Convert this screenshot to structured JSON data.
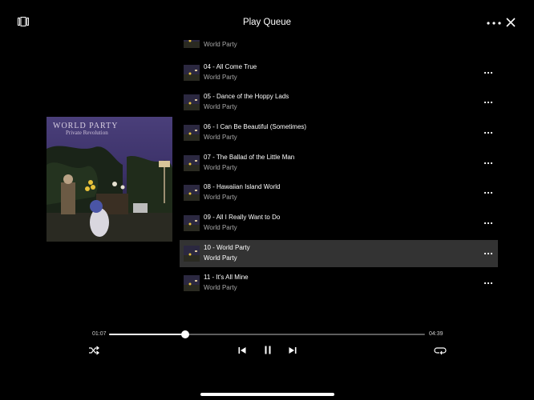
{
  "header": {
    "title": "Play Queue",
    "icons": {
      "left": "devices-icon",
      "more": "more-icon",
      "close": "close-icon"
    }
  },
  "album": {
    "art_text_band": "WORLD PARTY",
    "art_text_title": "Private Revolution"
  },
  "queue": {
    "partial_artist": "World Party",
    "tracks": [
      {
        "title": "04 - All Come True",
        "artist": "World Party",
        "active": false
      },
      {
        "title": "05 - Dance of the Hoppy Lads",
        "artist": "World Party",
        "active": false
      },
      {
        "title": "06 - I Can Be Beautiful (Sometimes)",
        "artist": "World Party",
        "active": false
      },
      {
        "title": "07 - The Ballad of the Little Man",
        "artist": "World Party",
        "active": false
      },
      {
        "title": "08 - Hawaiian Island World",
        "artist": "World Party",
        "active": false
      },
      {
        "title": "09 - All I Really Want to Do",
        "artist": "World Party",
        "active": false
      },
      {
        "title": "10 - World Party",
        "artist": "World Party",
        "active": true
      },
      {
        "title": "11 - It's All Mine",
        "artist": "World Party",
        "active": false
      }
    ]
  },
  "player": {
    "elapsed": "01:07",
    "duration": "04:39",
    "progress": 0.24,
    "controls": [
      "shuffle-icon",
      "previous-icon",
      "pause-icon",
      "next-icon",
      "repeat-icon"
    ]
  },
  "colors": {
    "background": "#000000",
    "active_row": "#333333",
    "secondary_text": "#a7a7a7",
    "track_bar": "#5e5e5e"
  }
}
